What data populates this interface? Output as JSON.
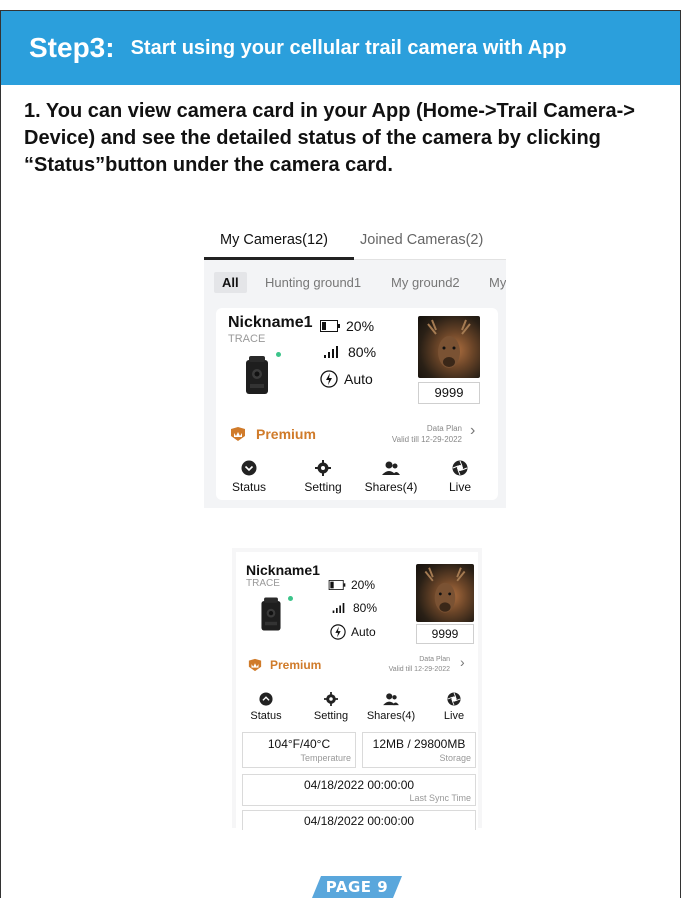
{
  "header": {
    "step": "Step3:",
    "subtitle": "Start using your cellular trail camera with App"
  },
  "intro": {
    "text": "1. You can view camera card in your App (Home->Trail Camera-> Device) and see the detailed status of the camera by clicking “Status”button under the camera card."
  },
  "app": {
    "tabs": [
      "My Cameras(12)",
      "Joined Cameras(2)"
    ],
    "filters": [
      "All",
      "Hunting ground1",
      "My ground2",
      "My"
    ],
    "camera": {
      "nickname": "Nickname1",
      "model": "TRACE",
      "battery": "20%",
      "signal": "80%",
      "mode": "Auto",
      "photo_count": "9999",
      "premium_label": "Premium",
      "data_plan_label": "Data Plan",
      "valid_till": "Valid till 12-29-2022"
    },
    "actions": [
      "Status",
      "Setting",
      "Shares(4)",
      "Live"
    ]
  },
  "status_panel": {
    "temperature_value": "104°F/40°C",
    "temperature_label": "Temperature",
    "storage_value": "12MB / 29800MB",
    "storage_label": "Storage",
    "last_sync_value": "04/18/2022 00:00:00",
    "last_sync_label": "Last Sync Time",
    "next_value": "04/18/2022 00:00:00"
  },
  "footer": {
    "page": "PAGE 9"
  },
  "colors": {
    "header_blue": "#2b9fdc",
    "premium_orange": "#d07b2a",
    "status_green": "#3cc48a",
    "page_badge_blue": "#5aa7dc"
  }
}
